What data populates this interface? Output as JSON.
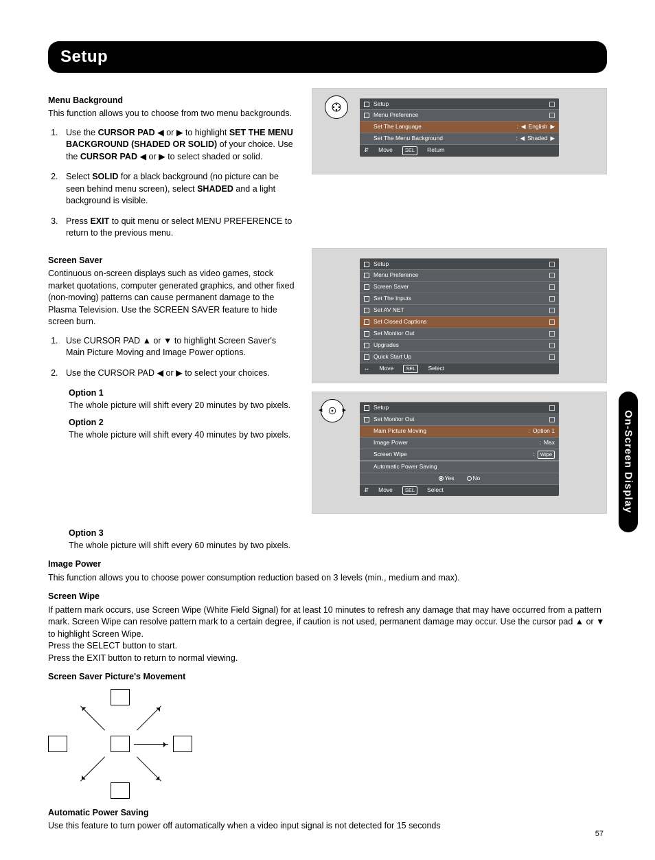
{
  "page_number": "57",
  "header_title": "Setup",
  "side_tab": "On-Screen Display",
  "mb": {
    "title": "Menu Background",
    "intro": "This function allows you to choose from two menu backgrounds.",
    "s1a": "Use the ",
    "s1b": "CURSOR PAD",
    "s1c": " ◀ or ▶ to highlight ",
    "s1d": "SET THE MENU BACKGROUND (SHADED OR SOLID)",
    "s1e": " of your choice.  Use the ",
    "s1f": "CURSOR PAD",
    "s1g": " ◀ or ▶ to select shaded or solid.",
    "s2a": "Select ",
    "s2b": "SOLID",
    "s2c": " for a black background (no picture can be seen behind menu screen), select ",
    "s2d": "SHADED",
    "s2e": " and a light background is visible.",
    "s3a": "Press ",
    "s3b": "EXIT",
    "s3c": " to quit menu or select MENU PREFERENCE to return to the previous menu."
  },
  "ss": {
    "title": "Screen Saver",
    "intro": "Continuous on-screen displays such as video games, stock market quotations, computer generated graphics, and other fixed (non-moving) patterns can cause permanent damage to the Plasma Television.  Use the SCREEN SAVER feature to hide screen burn.",
    "s1": "Use CURSOR PAD ▲ or ▼ to highlight Screen Saver's Main Picture Moving and Image Power options.",
    "s2": "Use the CURSOR PAD ◀ or ▶ to select your choices.",
    "o1t": "Option 1",
    "o1": "The whole picture will shift every 20 minutes by two pixels.",
    "o2t": "Option 2",
    "o2": "The whole picture will shift every 40 minutes by two pixels.",
    "o3t": "Option 3",
    "o3": "The whole picture will shift every 60 minutes by two pixels."
  },
  "ip": {
    "title": "Image Power",
    "body": "This function allows you to choose power consumption reduction based on 3 levels (min., medium and max)."
  },
  "sw": {
    "title": "Screen Wipe",
    "body": "If pattern mark occurs, use Screen Wipe (White Field Signal) for at least 10 minutes to refresh any damage that may have occurred from a pattern mark.  Screen Wipe can resolve pattern mark to a certain degree, if caution is not used, permanent damage may occur.  Use the cursor pad ▲ or ▼ to highlight Screen Wipe.",
    "l2": "Press the SELECT button to start.",
    "l3": "Press the EXIT button to return to normal viewing."
  },
  "mov_title": "Screen Saver Picture's Movement",
  "aps": {
    "title": "Automatic Power Saving",
    "body": "Use this feature to turn power off automatically when a video input signal is not detected for 15 seconds"
  },
  "osd1": {
    "t": "Setup",
    "sub": "Menu Preference",
    "r1a": "Set The Language",
    "r1b": "English",
    "r2a": "Set The Menu Background",
    "r2b": "Shaded",
    "fa": "Move",
    "fb": "Return",
    "sel": "SEL"
  },
  "osd2": {
    "t": "Setup",
    "items": [
      "Menu Preference",
      "Screen Saver",
      "Set The Inputs",
      "Set AV NET",
      "Set Closed Captions",
      "Set Monitor Out",
      "Upgrades",
      "Quick Start Up"
    ],
    "fa": "Move",
    "fb": "Select",
    "sel": "SEL"
  },
  "osd3": {
    "t": "Setup",
    "sub": "Set Monitor Out",
    "r1a": "Main Picture Moving",
    "r1b": "Option 1",
    "r2a": "Image Power",
    "r2b": "Max",
    "r3a": "Screen Wipe",
    "r3b": "Wipe",
    "aps": "Automatic Power Saving",
    "yes": "Yes",
    "no": "No",
    "fa": "Move",
    "fb": "Select",
    "sel": "SEL"
  }
}
